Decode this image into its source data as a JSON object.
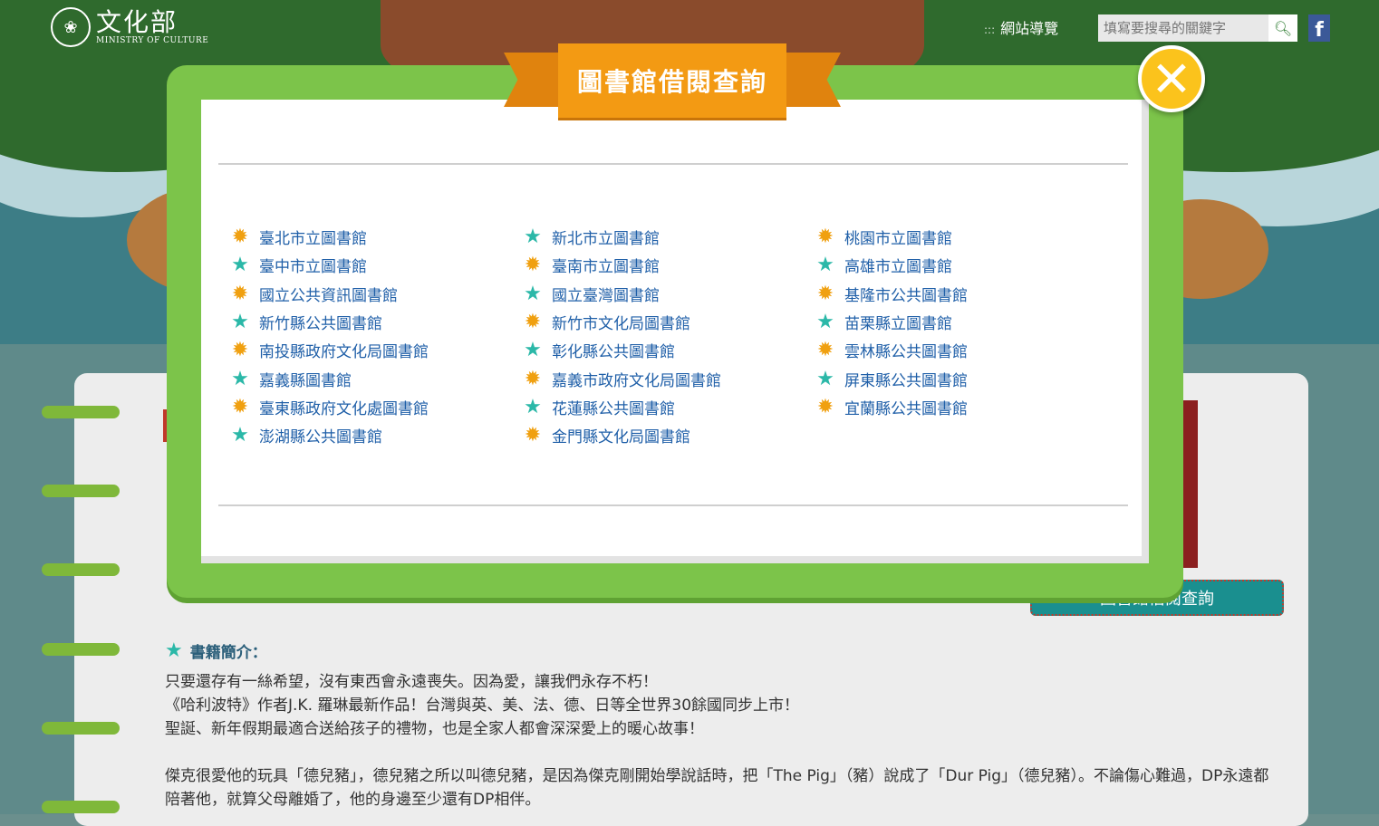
{
  "header": {
    "logo_cn": "文化部",
    "logo_en": "MINISTRY OF CULTURE",
    "nav_dots": ":::",
    "nav_link": "網站導覽",
    "search_placeholder": "填寫要搜尋的關鍵字",
    "facebook": "f"
  },
  "modal": {
    "title": "圖書館借閱查詢",
    "close": "✕",
    "libraries": {
      "col1": [
        "臺北市立圖書館",
        "臺中市立圖書館",
        "國立公共資訊圖書館",
        "新竹縣公共圖書館",
        "南投縣政府文化局圖書館",
        "嘉義縣圖書館",
        "臺東縣政府文化處圖書館",
        "澎湖縣公共圖書館"
      ],
      "col2": [
        "新北市立圖書館",
        "臺南市立圖書館",
        "國立臺灣圖書館",
        "新竹市文化局圖書館",
        "彰化縣公共圖書館",
        "嘉義市政府文化局圖書館",
        "花蓮縣公共圖書館",
        "金門縣文化局圖書館"
      ],
      "col3": [
        "桃園市立圖書館",
        "高雄市立圖書館",
        "基隆市公共圖書館",
        "苗栗縣立圖書館",
        "雲林縣公共圖書館",
        "屏東縣公共圖書館",
        "宜蘭縣公共圖書館"
      ]
    }
  },
  "page": {
    "borrow_button": "圖書館借閱查詢",
    "intro_heading": "書籍簡介：",
    "intro_lines": [
      "只要還存有一絲希望，沒有東西會永遠喪失。因為愛，讓我們永存不朽！",
      "《哈利波特》作者J.K. 羅琳最新作品！台灣與英、美、法、德、日等全世界30餘國同步上市！",
      "聖誕、新年假期最適合送給孩子的禮物，也是全家人都會深深愛上的暖心故事！",
      "傑克很愛他的玩具「德兒豬」，德兒豬之所以叫德兒豬，是因為傑克剛開始學說話時，把「The Pig」（豬）說成了「Dur Pig」（德兒豬）。不論傷心難過，DP永遠都陪著他，就算父母離婚了，他的身邊至少還有DP相伴。"
    ]
  }
}
